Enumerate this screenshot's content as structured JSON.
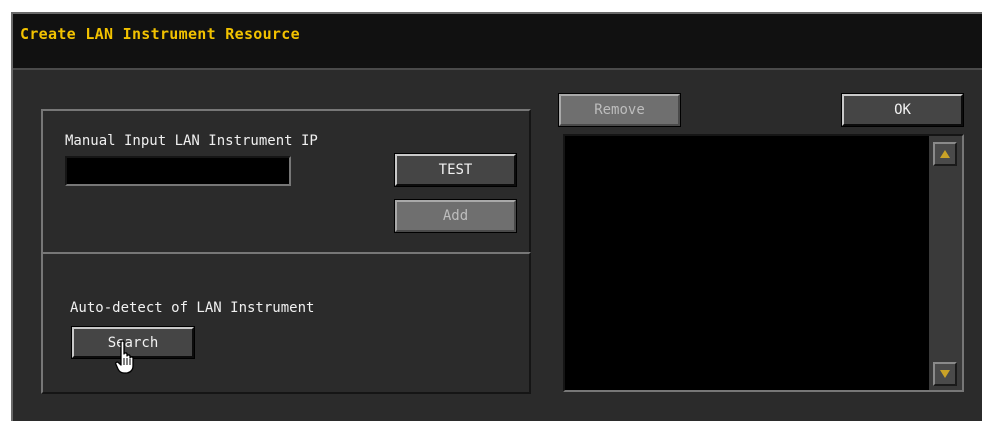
{
  "dialog": {
    "title": "Create LAN Instrument Resource"
  },
  "manual": {
    "label": "Manual Input LAN Instrument IP",
    "ip_value": "",
    "test_label": "TEST",
    "add_label": "Add"
  },
  "auto": {
    "label": "Auto-detect of LAN Instrument",
    "search_label": "Search"
  },
  "resources": {
    "remove_label": "Remove",
    "ok_label": "OK",
    "items": []
  },
  "colors": {
    "title": "#f2c200",
    "background": "#2b2b2b",
    "titlebar": "#111111",
    "scroll_arrow": "#c9a227"
  },
  "icons": {
    "cursor": "hand-pointer-icon",
    "scroll_up": "triangle-up-icon",
    "scroll_down": "triangle-down-icon"
  }
}
